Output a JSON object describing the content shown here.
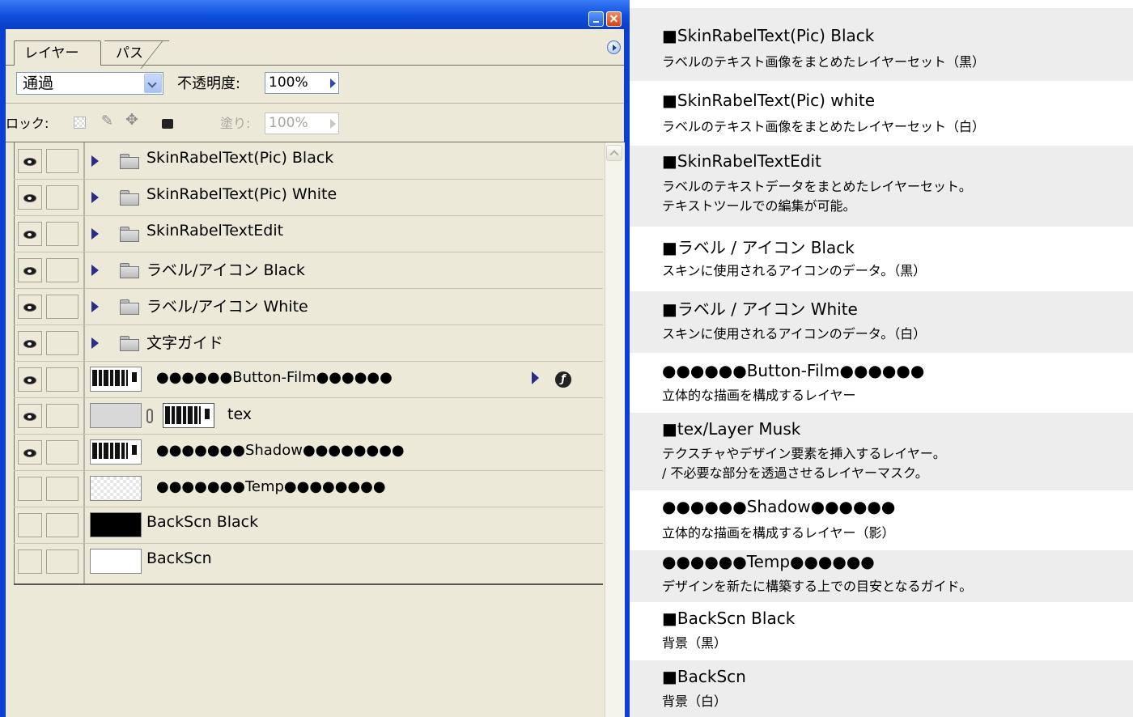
{
  "panel": {
    "tabs": [
      "レイヤー",
      "パス"
    ],
    "blend_mode": "通過",
    "opacity_label": "不透明度:",
    "opacity_value": "100%",
    "lock_label": "ロック:",
    "fill_label": "塗り:",
    "fill_value": "100%"
  },
  "layers": [
    {
      "name": "SkinRabelText(Pic) Black",
      "visible": true,
      "kind": "group"
    },
    {
      "name": "SkinRabelText(Pic) White",
      "visible": true,
      "kind": "group"
    },
    {
      "name": "SkinRabelTextEdit",
      "visible": true,
      "kind": "group"
    },
    {
      "name": "ラベル/アイコン Black",
      "visible": true,
      "kind": "group"
    },
    {
      "name": "ラベル/アイコン White",
      "visible": true,
      "kind": "group"
    },
    {
      "name": "文字ガイド",
      "visible": true,
      "kind": "group"
    },
    {
      "name": "●●●●●●Button-Film●●●●●●",
      "visible": true,
      "kind": "layer-fx"
    },
    {
      "name": "tex",
      "visible": true,
      "kind": "layer-mask"
    },
    {
      "name": "●●●●●●●Shadow●●●●●●●●",
      "visible": true,
      "kind": "layer"
    },
    {
      "name": "●●●●●●●Temp●●●●●●●●",
      "visible": false,
      "kind": "layer"
    },
    {
      "name": "BackScn Black",
      "visible": false,
      "kind": "fill-black"
    },
    {
      "name": "BackScn",
      "visible": false,
      "kind": "fill-white"
    }
  ],
  "descriptions": [
    {
      "title": "■SkinRabelText(Pic) Black",
      "lines": [
        "ラベルのテキスト画像をまとめたレイヤーセット（黒）"
      ]
    },
    {
      "title": "■SkinRabelText(Pic) white",
      "lines": [
        "ラベルのテキスト画像をまとめたレイヤーセット（白）"
      ]
    },
    {
      "title": "■SkinRabelTextEdit",
      "lines": [
        "ラベルのテキストデータをまとめたレイヤーセット。",
        "テキストツールでの編集が可能。"
      ]
    },
    {
      "title": "■ラベル / アイコン Black",
      "lines": [
        "スキンに使用されるアイコンのデータ。（黒）"
      ]
    },
    {
      "title": "■ラベル / アイコン White",
      "lines": [
        "スキンに使用されるアイコンのデータ。（白）"
      ]
    },
    {
      "title": "●●●●●●Button-Film●●●●●●",
      "lines": [
        "立体的な描画を構成するレイヤー"
      ]
    },
    {
      "title": "■tex/Layer Musk",
      "lines": [
        "テクスチャやデザイン要素を挿入するレイヤー。",
        "/ 不必要な部分を透過させるレイヤーマスク。"
      ]
    },
    {
      "title": "●●●●●●Shadow●●●●●●",
      "lines": [
        "立体的な描画を構成するレイヤー（影）"
      ]
    },
    {
      "title": "●●●●●●Temp●●●●●●",
      "lines": [
        "デザインを新たに構築する上での目安となるガイド。"
      ]
    },
    {
      "title": "■BackScn Black",
      "lines": [
        "背景（黒）"
      ]
    },
    {
      "title": "■BackScn",
      "lines": [
        "背景（白）"
      ]
    }
  ]
}
